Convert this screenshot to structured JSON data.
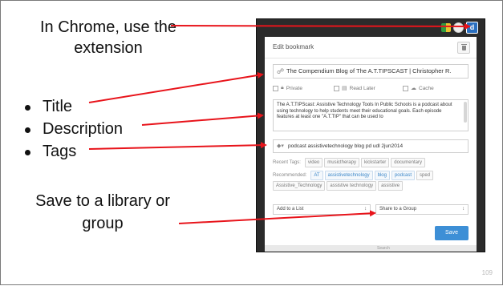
{
  "callouts": {
    "intro": "In Chrome, use the extension",
    "bullets": [
      "Title",
      "Description",
      "Tags"
    ],
    "save": "Save to a library or  group"
  },
  "page_number": "109",
  "popup": {
    "header_title": "Edit bookmark",
    "delete_icon": "trash-icon",
    "title_value": "The Compendium Blog of The A.T.TIPSCAST | Christopher R.",
    "options": {
      "private": "Private",
      "read_later": "Read Later",
      "cache": "Cache"
    },
    "description": "The A.T.TIPScast: Assistive Technology Tools In Public Schools is a podcast about using technology to help students meet their educational goals. Each episode features at least one \"A.T.TIP\" that can be used to",
    "tags_value": "podcast assistivetechnology blog pd udl 2jun2014",
    "recent_tags_label": "Recent Tags:",
    "recent_tags": [
      "video",
      "musictherapy",
      "kickstarter",
      "documentary"
    ],
    "recommended_label": "Recommended:",
    "recommended_tags": [
      {
        "text": "AT",
        "highlight": true
      },
      {
        "text": "assistivetechnology",
        "highlight": true
      },
      {
        "text": "blog",
        "highlight": true
      },
      {
        "text": "podcast",
        "highlight": true
      },
      {
        "text": "sped",
        "highlight": false
      },
      {
        "text": "Assistive_Technology",
        "highlight": false
      },
      {
        "text": "assistive technology",
        "highlight": false
      },
      {
        "text": "assistive",
        "highlight": false
      }
    ],
    "add_to_list": "Add to a List",
    "share_to_group": "Share to a Group",
    "save_button": "Save",
    "below_text": "Search"
  },
  "colors": {
    "arrow": "#e8141b",
    "save_button": "#3d8fd6",
    "highlight_tag": "#3a86c8"
  }
}
